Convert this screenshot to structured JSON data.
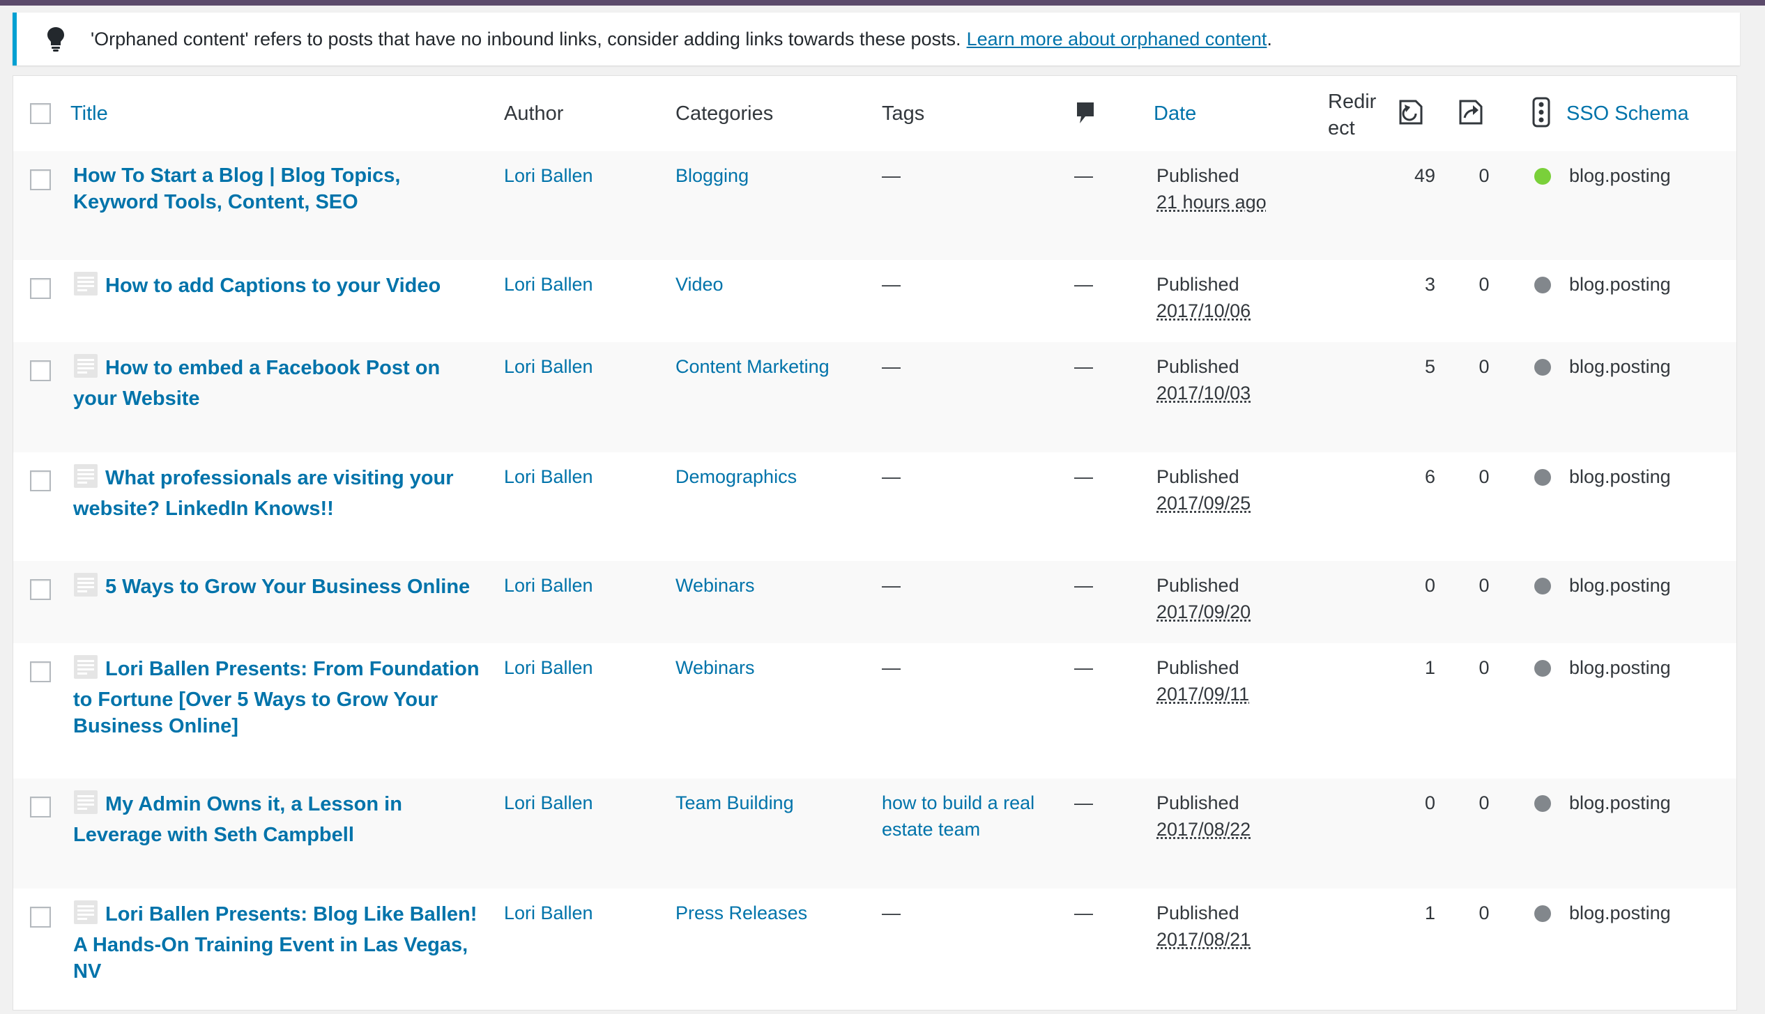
{
  "notice": {
    "message": "'Orphaned content' refers to posts that have no inbound links, consider adding links towards these posts.",
    "link_text": "Learn more about orphaned content",
    "end_punct": ".",
    "icon": "lightbulb-icon"
  },
  "columns": {
    "title": "Title",
    "author": "Author",
    "categories": "Categories",
    "tags": "Tags",
    "comments_icon": "comment-bubble-icon",
    "date": "Date",
    "redirect_line1": "Redir",
    "redirect_line2": "ect",
    "inbound_icon": "inbound-links-icon",
    "outbound_icon": "outbound-links-icon",
    "sso_icon": "traffic-light-icon",
    "sso_schema": "SSO Schema"
  },
  "colors": {
    "link": "#0073aa",
    "status_green": "#7ad03a",
    "status_gray": "#82878c"
  },
  "rows": [
    {
      "title_lines": [
        "How To Start a Blog | Blog Topics,",
        "Keyword Tools, Content, SEO"
      ],
      "has_icon": false,
      "author": "Lori Ballen",
      "category": "Blogging",
      "tags_lines": [
        "—"
      ],
      "comments": "—",
      "status": "Published",
      "date": "21 hours ago",
      "inbound": "49",
      "outbound": "0",
      "schema_status": "green",
      "schema": "blog.posting"
    },
    {
      "title_lines": [
        "How to add Captions to your Video"
      ],
      "has_icon": true,
      "author": "Lori Ballen",
      "category": "Video",
      "tags_lines": [
        "—"
      ],
      "comments": "—",
      "status": "Published",
      "date": "2017/10/06",
      "inbound": "3",
      "outbound": "0",
      "schema_status": "gray",
      "schema": "blog.posting"
    },
    {
      "title_lines": [
        "How to embed a Facebook Post on",
        "your Website"
      ],
      "has_icon": true,
      "author": "Lori Ballen",
      "category": "Content Marketing",
      "tags_lines": [
        "—"
      ],
      "comments": "—",
      "status": "Published",
      "date": "2017/10/03",
      "inbound": "5",
      "outbound": "0",
      "schema_status": "gray",
      "schema": "blog.posting"
    },
    {
      "title_lines": [
        "What professionals are visiting your",
        "website? LinkedIn Knows!!"
      ],
      "has_icon": true,
      "author": "Lori Ballen",
      "category": "Demographics",
      "tags_lines": [
        "—"
      ],
      "comments": "—",
      "status": "Published",
      "date": "2017/09/25",
      "inbound": "6",
      "outbound": "0",
      "schema_status": "gray",
      "schema": "blog.posting"
    },
    {
      "title_lines": [
        "5 Ways to Grow Your Business Online"
      ],
      "has_icon": true,
      "author": "Lori Ballen",
      "category": "Webinars",
      "tags_lines": [
        "—"
      ],
      "comments": "—",
      "status": "Published",
      "date": "2017/09/20",
      "inbound": "0",
      "outbound": "0",
      "schema_status": "gray",
      "schema": "blog.posting"
    },
    {
      "title_lines": [
        "Lori Ballen Presents: From Foundation",
        "to Fortune [Over 5 Ways to Grow Your",
        "Business Online]"
      ],
      "has_icon": true,
      "author": "Lori Ballen",
      "category": "Webinars",
      "tags_lines": [
        "—"
      ],
      "comments": "—",
      "status": "Published",
      "date": "2017/09/11",
      "inbound": "1",
      "outbound": "0",
      "schema_status": "gray",
      "schema": "blog.posting"
    },
    {
      "title_lines": [
        "My Admin Owns it, a Lesson in",
        "Leverage with Seth Campbell"
      ],
      "has_icon": true,
      "author": "Lori Ballen",
      "category": "Team Building",
      "tags_lines": [
        "how to build a real",
        "estate team"
      ],
      "comments": "—",
      "status": "Published",
      "date": "2017/08/22",
      "inbound": "0",
      "outbound": "0",
      "schema_status": "gray",
      "schema": "blog.posting"
    },
    {
      "title_lines": [
        "Lori Ballen Presents: Blog Like Ballen!",
        "A Hands-On Training Event in Las Vegas,",
        "NV"
      ],
      "has_icon": true,
      "author": "Lori Ballen",
      "category": "Press Releases",
      "tags_lines": [
        "—"
      ],
      "comments": "—",
      "status": "Published",
      "date": "2017/08/21",
      "inbound": "1",
      "outbound": "0",
      "schema_status": "gray",
      "schema": "blog.posting"
    }
  ]
}
